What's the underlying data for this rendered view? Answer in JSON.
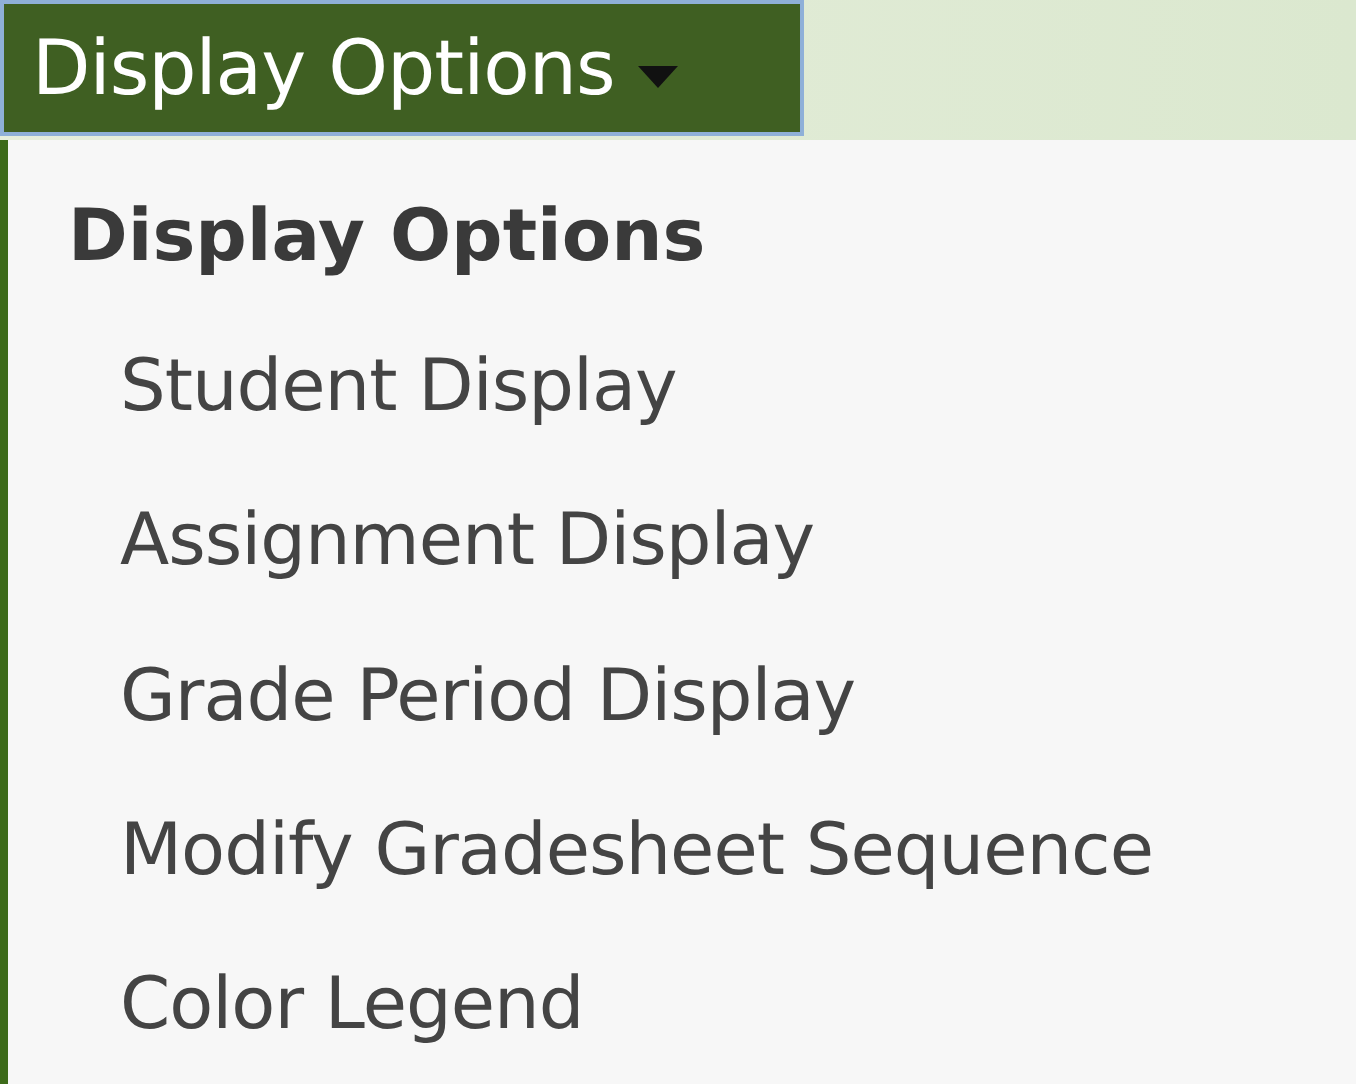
{
  "toolbar": {
    "button": {
      "label": "Display Options",
      "expanded": true
    }
  },
  "menu": {
    "header": "Display Options",
    "items": [
      {
        "label": "Student Display"
      },
      {
        "label": "Assignment Display"
      },
      {
        "label": "Grade Period Display"
      },
      {
        "label": "Modify Gradesheet Sequence"
      },
      {
        "label": "Color Legend"
      }
    ]
  }
}
